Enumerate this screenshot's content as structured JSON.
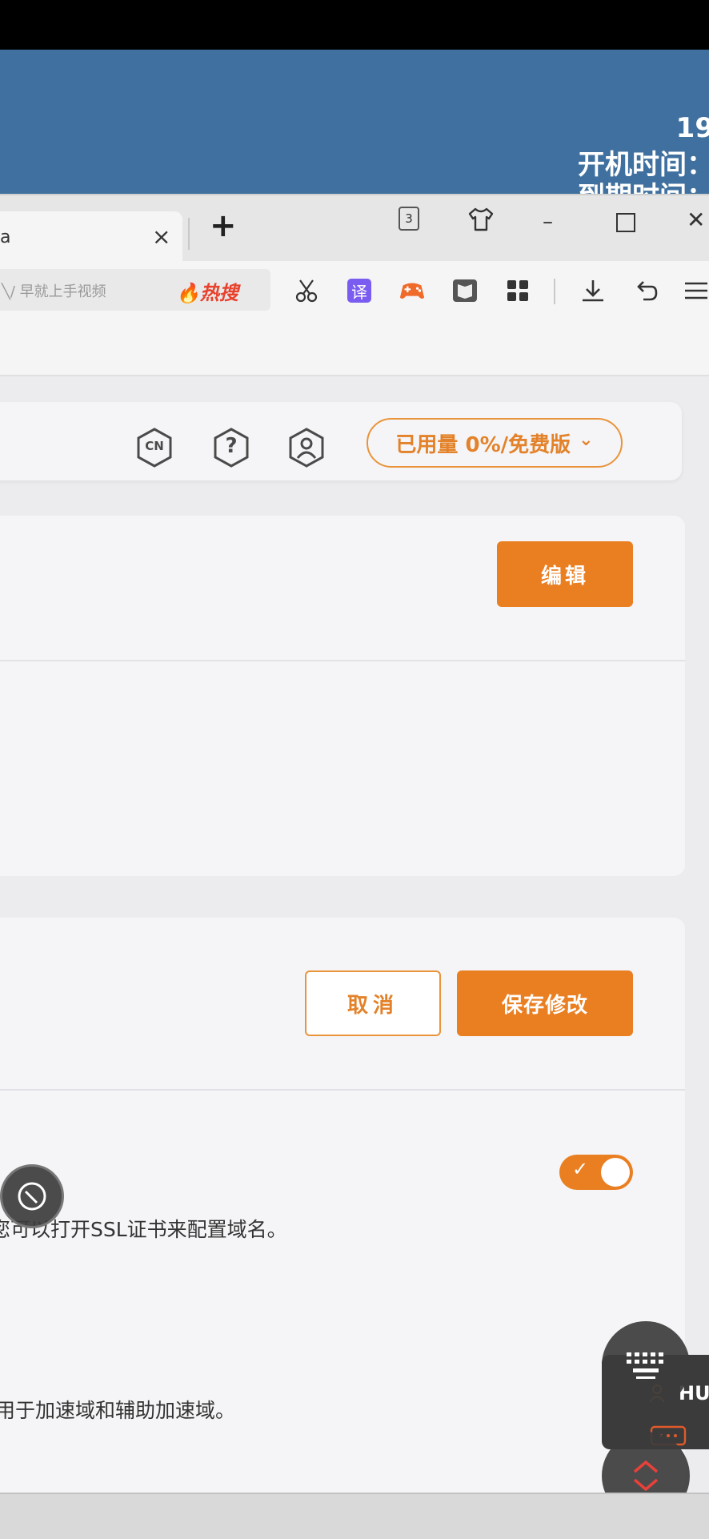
{
  "desktop": {
    "line1": "19",
    "line2": "开机时间：",
    "line3": "到期时间："
  },
  "browser": {
    "tab": {
      "title": "a",
      "close_glyph": "×"
    },
    "new_tab_glyph": "+",
    "tab_count": "3",
    "window_controls": {
      "minimize": "–",
      "maximize": "☐",
      "close": "✕"
    },
    "address_placeholder": "╲/ 早就上手视频",
    "hot_search_label": "热搜",
    "toolbar_icons": [
      "scissors-icon",
      "translate-icon",
      "game-controller-icon",
      "reader-icon",
      "apps-grid-icon",
      "download-icon",
      "undo-icon",
      "menu-icon"
    ],
    "translate_glyph": "译"
  },
  "header": {
    "lang_label": "CN",
    "help_glyph": "?",
    "usage_label": "已用量 0%/免费版",
    "usage_chevron": "⌄"
  },
  "card1": {
    "edit_button": "编辑"
  },
  "card2": {
    "cancel_button": "取消",
    "save_button": "保存修改",
    "ssl_toggle_on": true,
    "toggle_check": "✓",
    "ssl_desc": "您可以打开SSL证书来配置域名。",
    "accel_desc": "用于加速域和辅助加速域。"
  },
  "assistant": {
    "label": "HU"
  },
  "colors": {
    "accent": "#ea7f22",
    "desktop_bg": "#40709f",
    "hot": "#e8412c"
  }
}
